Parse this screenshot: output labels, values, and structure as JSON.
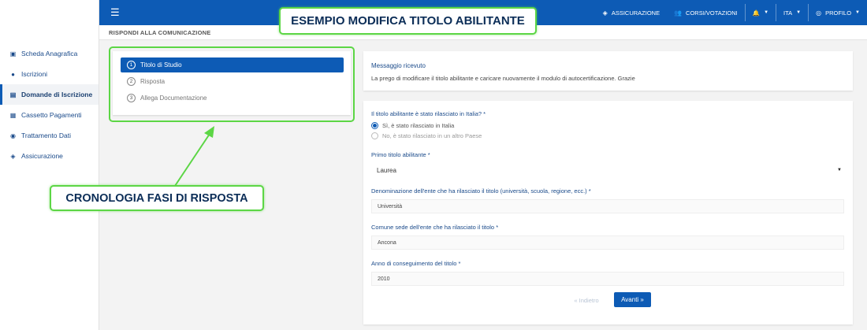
{
  "sidebar": {
    "items": [
      {
        "label": "Scheda Anagrafica",
        "icon": "id-card-icon"
      },
      {
        "label": "Iscrizioni",
        "icon": "user-icon"
      },
      {
        "label": "Domande di Iscrizione",
        "icon": "form-icon",
        "active": true
      },
      {
        "label": "Cassetto Pagamenti",
        "icon": "document-icon"
      },
      {
        "label": "Trattamento Dati",
        "icon": "eye-icon"
      },
      {
        "label": "Assicurazione",
        "icon": "shield-icon"
      }
    ]
  },
  "topbar": {
    "menu_icon": "hamburger-icon",
    "assicurazione": "ASSICURAZIONE",
    "corsi": "CORSI/VOTAZIONI",
    "lang": "ITA",
    "profilo": "PROFILO",
    "accent": "#0d5bb5"
  },
  "page": {
    "header": "RISPONDI ALLA COMUNICAZIONE"
  },
  "steps": [
    {
      "num": "1",
      "label": "Titolo di Studio",
      "active": true
    },
    {
      "num": "2",
      "label": "Risposta"
    },
    {
      "num": "3",
      "label": "Allega Documentazione"
    }
  ],
  "message": {
    "title": "Messaggio ricevuto",
    "body": "La prego di modificare il titolo abilitante e caricare nuovamente il modulo di autocertificazione. Grazie"
  },
  "form": {
    "q_rilasciato": "Il titolo abilitante è stato rilasciato in Italia? *",
    "opt_italia": "Sì, è stato rilasciato in Italia",
    "opt_estero": "No, è stato rilasciato in un altro Paese",
    "primo_titolo_label": "Primo titolo abilitante *",
    "primo_titolo_value": "Laurea",
    "ente_label": "Denominazione dell'ente che ha rilasciato il titolo (università, scuola, regione, ecc.) *",
    "ente_value": "Università",
    "comune_label": "Comune sede dell'ente che ha rilasciato il titolo *",
    "comune_value": "Ancona",
    "anno_label": "Anno di conseguimento del titolo *",
    "anno_value": "2010",
    "back_label": "« Indietro",
    "next_label": "Avanti »"
  },
  "annotations": {
    "top": "ESEMPIO MODIFICA TITOLO ABILITANTE",
    "left": "CRONOLOGIA FASI DI RISPOSTA",
    "color": "#5cd645"
  }
}
